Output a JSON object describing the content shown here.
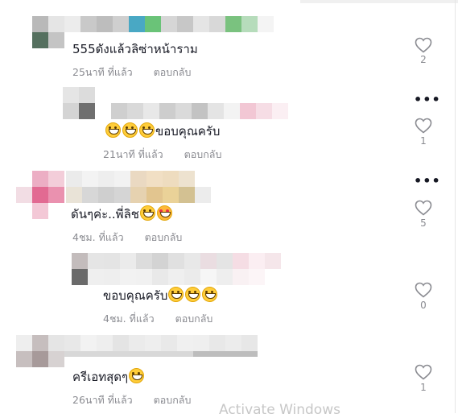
{
  "comments": [
    {
      "text": "555ดังแล้วลิซ่าหน้าราม",
      "time": "25นาที ที่แล้ว",
      "reply_label": "ตอบกลับ",
      "likes": "2"
    },
    {
      "text": "ขอบคุณครับ",
      "time": "21นาที ที่แล้ว",
      "reply_label": "ตอบกลับ",
      "likes": "1"
    },
    {
      "text": "ดันๆค่ะ..พี่ลิช",
      "time": "4ชม. ที่แล้ว",
      "reply_label": "ตอบกลับ",
      "likes": "5"
    },
    {
      "text": "ขอบคุณครับ",
      "time": "4ชม. ที่แล้ว",
      "reply_label": "ตอบกลับ",
      "likes": "0"
    },
    {
      "text": "ครีเอทสุดๆ",
      "time": "26นาที ที่แล้ว",
      "reply_label": "ตอบกลับ",
      "likes": "1"
    }
  ],
  "more_label": "•••",
  "watermark": "Activate Windows",
  "icons": {
    "like": "heart-outline-icon",
    "more": "more-dots-icon",
    "grin": "grinning-face-emoji",
    "love": "smiling-face-with-hearts-emoji"
  },
  "colors": {
    "text": "#161823",
    "muted": "#8a8b91",
    "heart_stroke": "#8a8b91"
  }
}
